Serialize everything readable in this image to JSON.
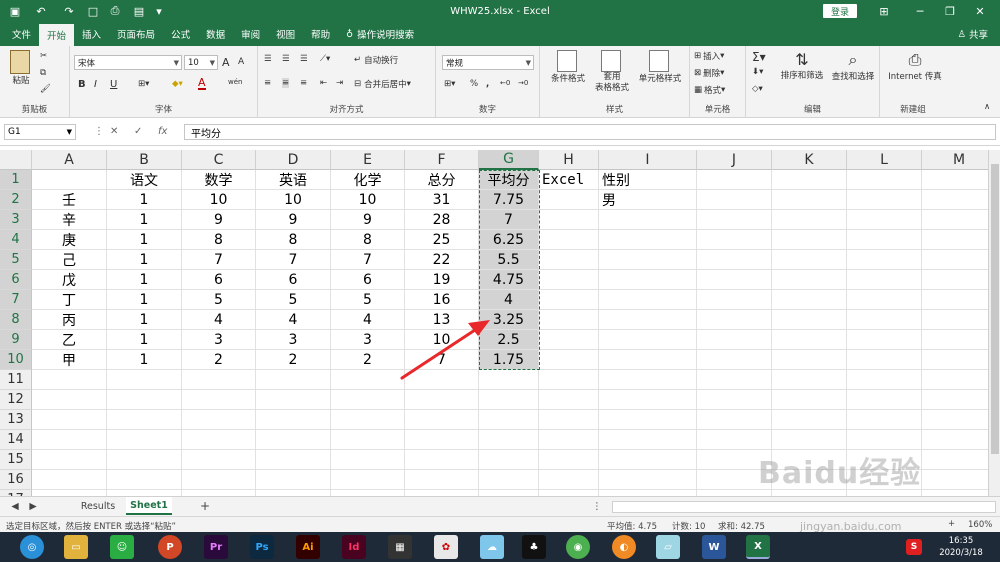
{
  "titlebar": {
    "title": "WHW25.xlsx  -  Excel",
    "login_label": "登录",
    "minimize": "─",
    "restore": "❐",
    "close": "✕"
  },
  "tabs": [
    "文件",
    "开始",
    "插入",
    "页面布局",
    "公式",
    "数据",
    "审阅",
    "视图",
    "帮助"
  ],
  "active_tab": "开始",
  "tell_me": "操作说明搜索",
  "share_label": "共享",
  "ribbon": {
    "clipboard": {
      "paste_label": "粘贴",
      "group_label": "剪贴板"
    },
    "font": {
      "font_name": "宋体",
      "font_size": "10",
      "size_up": "A",
      "size_down": "A",
      "bold": "B",
      "italic": "I",
      "underline": "U",
      "font_color": "A",
      "phonetic": "wén",
      "group_label": "字体"
    },
    "alignment": {
      "wrap_label": "自动换行",
      "merge_label": "合并后居中",
      "group_label": "对齐方式"
    },
    "number": {
      "format": "常规",
      "percent": "%",
      "comma": ",",
      "group_label": "数字"
    },
    "styles": {
      "conditional_label": "条件格式",
      "table_label1": "套用",
      "table_label2": "表格格式",
      "cell_style_label": "单元格样式",
      "group_label": "样式"
    },
    "cells": {
      "insert_label": "插入",
      "delete_label": "删除",
      "format_label": "格式",
      "group_label": "单元格"
    },
    "editing": {
      "sort_label": "排序和筛选",
      "find_label": "查找和选择",
      "group_label": "编辑"
    },
    "newgroup": {
      "ie_label": "Internet 传真",
      "group_label": "新建组"
    }
  },
  "formula_bar": {
    "name_box": "G1",
    "fx": "fx",
    "cancel": "✕",
    "enter": "✓",
    "content": "平均分"
  },
  "columns": [
    "A",
    "B",
    "C",
    "D",
    "E",
    "F",
    "G",
    "H",
    "I",
    "J",
    "K",
    "L",
    "M"
  ],
  "rows": [
    "1",
    "2",
    "3",
    "4",
    "5",
    "6",
    "7",
    "8",
    "9",
    "10",
    "11",
    "12",
    "13",
    "14",
    "15",
    "16",
    "17"
  ],
  "cells": {
    "header": [
      "",
      "语文",
      "数学",
      "英语",
      "化学",
      "总分",
      "平均分",
      "Excel",
      "性别"
    ],
    "data": [
      [
        "壬",
        "1",
        "10",
        "10",
        "10",
        "31",
        "7.75",
        "",
        "男"
      ],
      [
        "辛",
        "1",
        "9",
        "9",
        "9",
        "28",
        "7",
        "",
        ""
      ],
      [
        "庚",
        "1",
        "8",
        "8",
        "8",
        "25",
        "6.25",
        "",
        ""
      ],
      [
        "己",
        "1",
        "7",
        "7",
        "7",
        "22",
        "5.5",
        "",
        ""
      ],
      [
        "戊",
        "1",
        "6",
        "6",
        "6",
        "19",
        "4.75",
        "",
        ""
      ],
      [
        "丁",
        "1",
        "5",
        "5",
        "5",
        "16",
        "4",
        "",
        ""
      ],
      [
        "丙",
        "1",
        "4",
        "4",
        "4",
        "13",
        "3.25",
        "",
        ""
      ],
      [
        "乙",
        "1",
        "3",
        "3",
        "3",
        "10",
        "2.5",
        "",
        ""
      ],
      [
        "甲",
        "1",
        "2",
        "2",
        "2",
        "7",
        "1.75",
        "",
        ""
      ]
    ]
  },
  "sheets": [
    "Results",
    "Sheet1"
  ],
  "active_sheet": "Sheet1",
  "add_sheet": "+",
  "status": {
    "message": "选定目标区域，然后按 ENTER 或选择“粘贴”",
    "average": "平均值: 4.75",
    "count": "计数: 10",
    "sum": "求和: 42.75",
    "zoom": "160%"
  },
  "taskbar": {
    "time": "16:35",
    "date": "2020/3/18",
    "apps": [
      "Pr",
      "Ps",
      "Ai",
      "Id",
      "Excel"
    ]
  },
  "watermark": "Baidu经验",
  "watermark_url": "jingyan.baidu.com",
  "colors": {
    "accent": "#217346",
    "selection": "#d3d3d3",
    "arrow": "#e8282b"
  }
}
